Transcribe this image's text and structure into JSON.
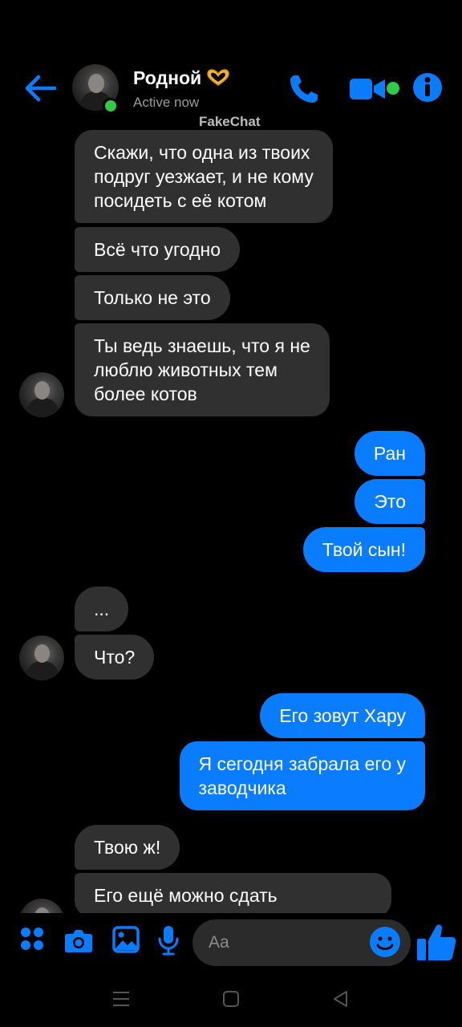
{
  "header": {
    "contact_name": "Родной",
    "status": "Active now",
    "watermark": "FakeChat"
  },
  "colors": {
    "accent": "#0a7cff",
    "received_bubble": "#303030",
    "online": "#31cc46",
    "background": "#000000"
  },
  "icons": [
    "back-arrow-icon",
    "phone-icon",
    "video-camera-icon",
    "info-icon",
    "apps-grid-icon",
    "camera-icon",
    "gallery-icon",
    "microphone-icon",
    "smiley-icon",
    "thumbs-up-icon"
  ],
  "messages": [
    {
      "dir": "received",
      "text": "Скажи, что одна из твоих\nподруг уезжает, и не кому\nпосидеть с её котом"
    },
    {
      "dir": "received",
      "text": "Всё что угодно"
    },
    {
      "dir": "received",
      "text": "Только не это"
    },
    {
      "dir": "received",
      "text": "Ты ведь знаешь, что я не\nлюблю животных  тем\nболее котов"
    },
    {
      "dir": "sent",
      "text": "Ран"
    },
    {
      "dir": "sent",
      "text": "Это"
    },
    {
      "dir": "sent",
      "text": "Твой сын!"
    },
    {
      "dir": "received",
      "text": "..."
    },
    {
      "dir": "received",
      "text": "Что?"
    },
    {
      "dir": "sent",
      "text": "Его зовут Хару"
    },
    {
      "dir": "sent",
      "text": "Я сегодня забрала его у\nзаводчика"
    },
    {
      "dir": "received",
      "text": "Твою ж!"
    },
    {
      "dir": "received",
      "text": "Его ещё можно сдать"
    }
  ],
  "composer": {
    "placeholder": "Aa"
  }
}
